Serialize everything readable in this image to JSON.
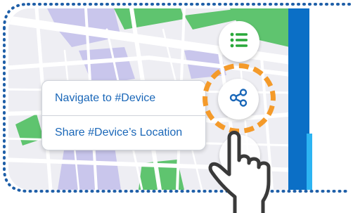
{
  "popup_menu": {
    "items": [
      {
        "label": "Navigate to #Device"
      },
      {
        "label": "Share #Device’s Location"
      }
    ]
  },
  "buttons": {
    "list": {
      "icon": "list-icon"
    },
    "share": {
      "icon": "share-icon"
    }
  },
  "colors": {
    "accent_blue": "#1a67b8",
    "side_blue": "#0b6fc6",
    "highlight_orange": "#f49a2a",
    "icon_green": "#29a83a",
    "park_green": "#5fc46f",
    "district_purple": "#c9c6ec",
    "border_dots": "#1f5fa8"
  }
}
